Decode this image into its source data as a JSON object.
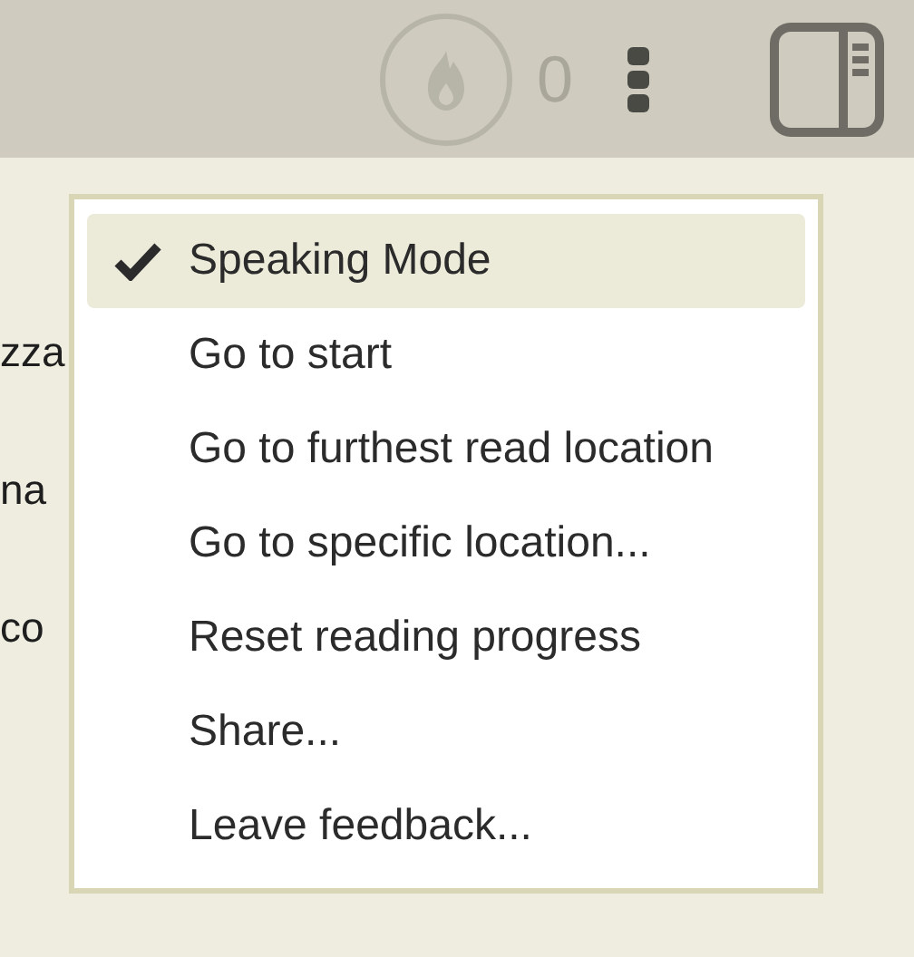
{
  "toolbar": {
    "streak_count": "0"
  },
  "page_text": [
    "zza",
    "na",
    "co"
  ],
  "menu": {
    "items": [
      {
        "label": "Speaking Mode",
        "checked": true,
        "selected": true
      },
      {
        "label": "Go to start",
        "checked": false,
        "selected": false
      },
      {
        "label": "Go to furthest read location",
        "checked": false,
        "selected": false
      },
      {
        "label": "Go to specific location...",
        "checked": false,
        "selected": false
      },
      {
        "label": "Reset reading progress",
        "checked": false,
        "selected": false
      },
      {
        "label": "Share...",
        "checked": false,
        "selected": false
      },
      {
        "label": "Leave feedback...",
        "checked": false,
        "selected": false
      }
    ]
  }
}
